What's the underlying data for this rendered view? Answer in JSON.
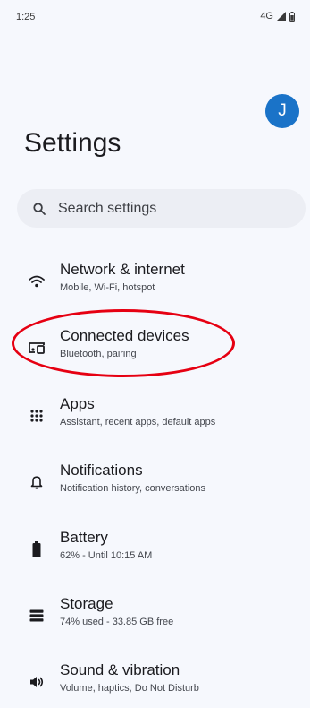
{
  "status_bar": {
    "time": "1:25",
    "network": "4G"
  },
  "profile": {
    "avatar_initial": "J",
    "avatar_color": "#1a73c8"
  },
  "page": {
    "title": "Settings"
  },
  "search": {
    "placeholder": "Search settings"
  },
  "settings": [
    {
      "icon": "wifi-icon",
      "title": "Network & internet",
      "subtitle": "Mobile, Wi-Fi, hotspot"
    },
    {
      "icon": "connected-devices-icon",
      "title": "Connected devices",
      "subtitle": "Bluetooth, pairing"
    },
    {
      "icon": "apps-grid-icon",
      "title": "Apps",
      "subtitle": "Assistant, recent apps, default apps"
    },
    {
      "icon": "bell-icon",
      "title": "Notifications",
      "subtitle": "Notification history, conversations"
    },
    {
      "icon": "battery-icon",
      "title": "Battery",
      "subtitle": "62% - Until 10:15 AM"
    },
    {
      "icon": "storage-icon",
      "title": "Storage",
      "subtitle": "74% used - 33.85 GB free"
    },
    {
      "icon": "speaker-icon",
      "title": "Sound & vibration",
      "subtitle": "Volume, haptics, Do Not Disturb"
    }
  ],
  "annotation": {
    "highlight_color": "#e60012",
    "highlighted_item": "Connected devices"
  }
}
